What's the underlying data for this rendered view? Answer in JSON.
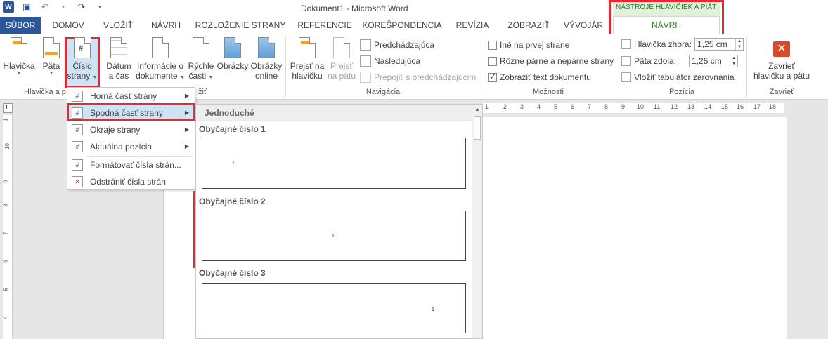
{
  "title_bar": {
    "title": "Dokument1 - Microsoft Word"
  },
  "context_group": {
    "label": "NÁSTROJE HLAVIČIEK A PIÁT"
  },
  "tabs": [
    {
      "label": "SÚBOR"
    },
    {
      "label": "DOMOV"
    },
    {
      "label": "VLOŽIŤ"
    },
    {
      "label": "NÁVRH"
    },
    {
      "label": "ROZLOŽENIE STRANY"
    },
    {
      "label": "REFERENCIE"
    },
    {
      "label": "KOREŠPONDENCIA"
    },
    {
      "label": "REVÍZIA"
    },
    {
      "label": "ZOBRAZIŤ"
    },
    {
      "label": "VÝVOJÁR"
    },
    {
      "label": "NÁVRH"
    }
  ],
  "ribbon": {
    "hlavicka": {
      "line1": "Hlavička"
    },
    "pata": {
      "line1": "Päta"
    },
    "cislo": {
      "line1": "Číslo",
      "line2": "strany"
    },
    "datum": {
      "line1": "Dátum",
      "line2": "a čas"
    },
    "informacie": {
      "line1": "Informácie o",
      "line2": "dokumente"
    },
    "rychle": {
      "line1": "Rýchle",
      "line2": "časti"
    },
    "obrazky": {
      "line1": "Obrázky"
    },
    "obrazky_online": {
      "line1": "Obrázky",
      "line2": "online"
    },
    "prejst_hlavicka": {
      "line1": "Prejsť na",
      "line2": "hlavičku"
    },
    "prejst_pata": {
      "line1": "Prejsť",
      "line2": "na pätu"
    },
    "predchadzajuca": "Predchádzajúca",
    "nasledujuca": "Nasledujúca",
    "prepojit": "Prepojiť s predchádzajúcim",
    "ine_prva": "Iné na prvej strane",
    "rozne": "Rôzne párne a nepárne strany",
    "zobrazit_text": "Zobraziť text dokumentu",
    "hlavicka_zhora_label": "Hlavička zhora:",
    "hlavicka_zhora_value": "1,25 cm",
    "pata_zdola_label": "Päta zdola:",
    "pata_zdola_value": "1,25 cm",
    "vlozit_tab": "Vložiť tabulátor zarovnania",
    "zavriet": {
      "line1": "Zavrieť",
      "line2": "hlavičku a pätu"
    },
    "groups": {
      "hlavicka_pata": "Hlavička a p",
      "vlozit_partial": "žiť",
      "navigacia": "Navigácia",
      "moznosti": "Možnosti",
      "pozicia": "Pozícia",
      "zavriet": "Zavrieť"
    }
  },
  "menu": {
    "items": [
      {
        "label": "Horná časť strany"
      },
      {
        "label": "Spodná časť strany"
      },
      {
        "label": "Okraje strany"
      },
      {
        "label": "Aktuálna pozícia"
      },
      {
        "label": "Formátovať čísla strán..."
      },
      {
        "label": "Odstrániť čísla strán"
      }
    ]
  },
  "gallery": {
    "header": "Jednoduché",
    "items": [
      {
        "title": "Obyčajné číslo 1",
        "num": "1"
      },
      {
        "title": "Obyčajné číslo 2",
        "num": "1"
      },
      {
        "title": "Obyčajné číslo 3",
        "num": "1"
      }
    ]
  },
  "ruler": {
    "h": [
      "1",
      "2",
      "3",
      "4",
      "5",
      "6",
      "7",
      "8",
      "9",
      "10",
      "11",
      "12",
      "13",
      "14",
      "15",
      "16",
      "17",
      "18"
    ],
    "v": [
      "1",
      "10",
      "9",
      "8",
      "7",
      "6",
      "5",
      "4"
    ]
  }
}
